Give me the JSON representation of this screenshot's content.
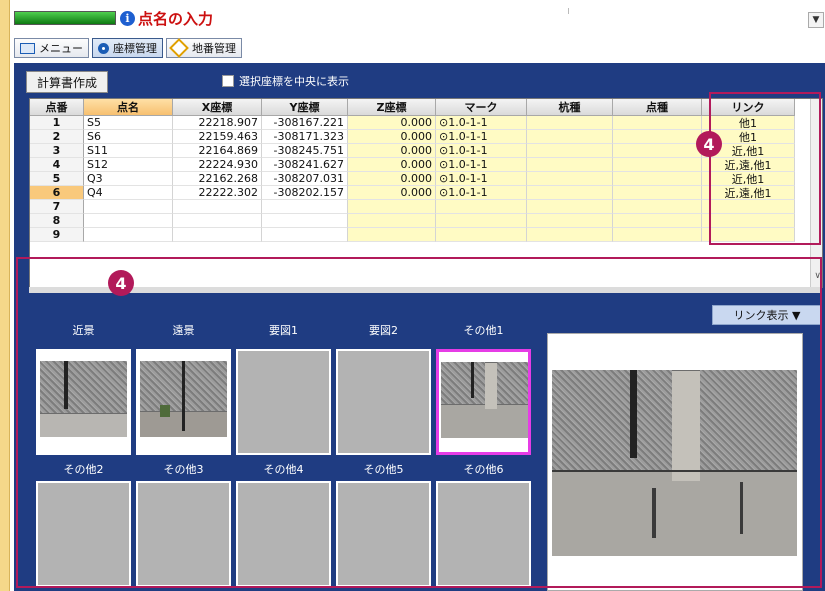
{
  "header": {
    "title": "点名の入力"
  },
  "toolbar": {
    "menu_label": "メニュー",
    "coord_label": "座標管理",
    "lot_label": "地番管理"
  },
  "controls": {
    "calc_button": "計算書作成",
    "center_checkbox_label": "選択座標を中央に表示"
  },
  "table": {
    "headers": [
      "点番",
      "点名",
      "X座標",
      "Y座標",
      "Z座標",
      "マーク",
      "杭種",
      "点種",
      "リンク"
    ],
    "rows": [
      {
        "no": "1",
        "name": "S5",
        "x": "22218.907",
        "y": "-308167.221",
        "z": "0.000",
        "mark": "⊙1.0-1-1",
        "link": "他1"
      },
      {
        "no": "2",
        "name": "S6",
        "x": "22159.463",
        "y": "-308171.323",
        "z": "0.000",
        "mark": "⊙1.0-1-1",
        "link": "他1"
      },
      {
        "no": "3",
        "name": "S11",
        "x": "22164.869",
        "y": "-308245.751",
        "z": "0.000",
        "mark": "⊙1.0-1-1",
        "link": "近,他1"
      },
      {
        "no": "4",
        "name": "S12",
        "x": "22224.930",
        "y": "-308241.627",
        "z": "0.000",
        "mark": "⊙1.0-1-1",
        "link": "近,遠,他1"
      },
      {
        "no": "5",
        "name": "Q3",
        "x": "22162.268",
        "y": "-308207.031",
        "z": "0.000",
        "mark": "⊙1.0-1-1",
        "link": "近,他1"
      },
      {
        "no": "6",
        "name": "Q4",
        "x": "22222.302",
        "y": "-308202.157",
        "z": "0.000",
        "mark": "⊙1.0-1-1",
        "link": "近,遠,他1"
      },
      {
        "no": "7",
        "name": "",
        "x": "",
        "y": "",
        "z": "",
        "mark": "",
        "link": ""
      },
      {
        "no": "8",
        "name": "",
        "x": "",
        "y": "",
        "z": "",
        "mark": "",
        "link": ""
      },
      {
        "no": "9",
        "name": "",
        "x": "",
        "y": "",
        "z": "",
        "mark": "",
        "link": ""
      }
    ],
    "selected_row": "6"
  },
  "callouts": {
    "badge_1": "4",
    "badge_2": "4"
  },
  "photos": {
    "link_display_button": "リンク表示 ▼",
    "slots": [
      "近景",
      "遠景",
      "要図1",
      "要図2",
      "その他1",
      "その他2",
      "その他3",
      "その他4",
      "その他5",
      "その他6"
    ],
    "selected_slot": "その他1"
  },
  "colors": {
    "panel_bg": "#1f3c82",
    "title_red": "#cc1010",
    "callout": "#b21a5a",
    "selected_slot_border": "#e63ce6",
    "editable_yellow": "#fffbc4"
  }
}
